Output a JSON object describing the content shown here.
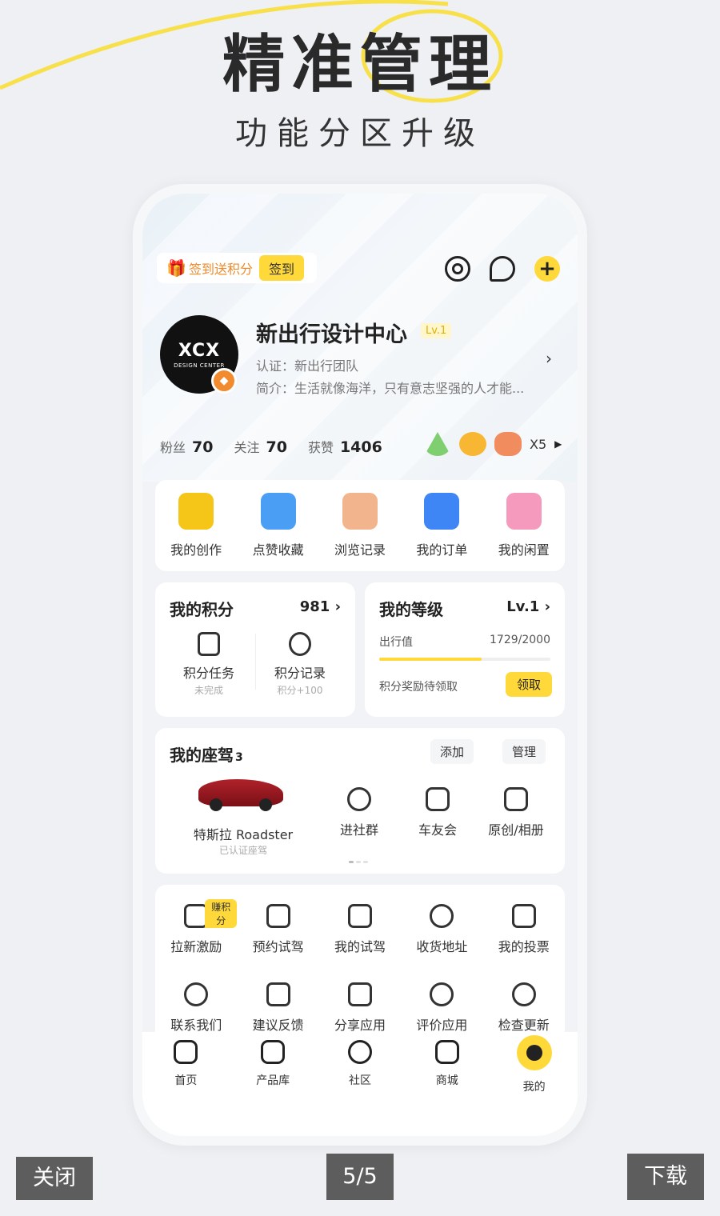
{
  "hero": {
    "title": "精准管理",
    "subtitle": "功能分区升级",
    "accent": "#ffd83a"
  },
  "top_bar": {
    "signin_label": "签到送积分",
    "signin_button": "签到",
    "icons": [
      "settings-icon",
      "message-icon",
      "add-icon"
    ]
  },
  "profile": {
    "avatar_logo": "XCX",
    "avatar_tag": "DESIGN CENTER",
    "name": "新出行设计中心",
    "level_tag": "Lv.1",
    "cert": "认证：新出行团队",
    "intro": "简介：生活就像海洋，只有意志坚强的人才能..."
  },
  "stats": [
    {
      "label": "粉丝",
      "value": "70"
    },
    {
      "label": "关注",
      "value": "70"
    },
    {
      "label": "获赞",
      "value": "1406"
    }
  ],
  "medals_count": "X5",
  "quick_actions": [
    {
      "label": "我的创作",
      "color": "#f5c518"
    },
    {
      "label": "点赞收藏",
      "color": "#4a9ff5"
    },
    {
      "label": "浏览记录",
      "color": "#f2b48c"
    },
    {
      "label": "我的订单",
      "color": "#3e86f5"
    },
    {
      "label": "我的闲置",
      "color": "#f59abd"
    }
  ],
  "points": {
    "title": "我的积分",
    "value": "981",
    "task_label": "积分任务",
    "task_sub": "未完成",
    "record_label": "积分记录",
    "record_sub": "积分+100"
  },
  "level": {
    "title": "我的等级",
    "value": "Lv.1",
    "metric_label": "出行值",
    "metric_value": "1729/2000",
    "progress": 0.6,
    "reward_label": "积分奖励待领取",
    "claim_button": "领取"
  },
  "seats": {
    "title": "我的座驾",
    "count": "3",
    "add_button": "添加",
    "manage_button": "管理",
    "car_name": "特斯拉 Roadster",
    "car_sub": "已认证座驾",
    "items": [
      "进社群",
      "车友会",
      "原创/相册"
    ]
  },
  "tools": {
    "earn_badge": "赚积分",
    "row1": [
      "拉新激励",
      "预约试驾",
      "我的试驾",
      "收货地址",
      "我的投票"
    ],
    "row2": [
      "联系我们",
      "建议反馈",
      "分享应用",
      "评价应用",
      "检查更新"
    ]
  },
  "tabbar": [
    "首页",
    "产品库",
    "社区",
    "商城",
    "我的"
  ],
  "overlay": {
    "close": "关闭",
    "page": "5/5",
    "download": "下载"
  }
}
